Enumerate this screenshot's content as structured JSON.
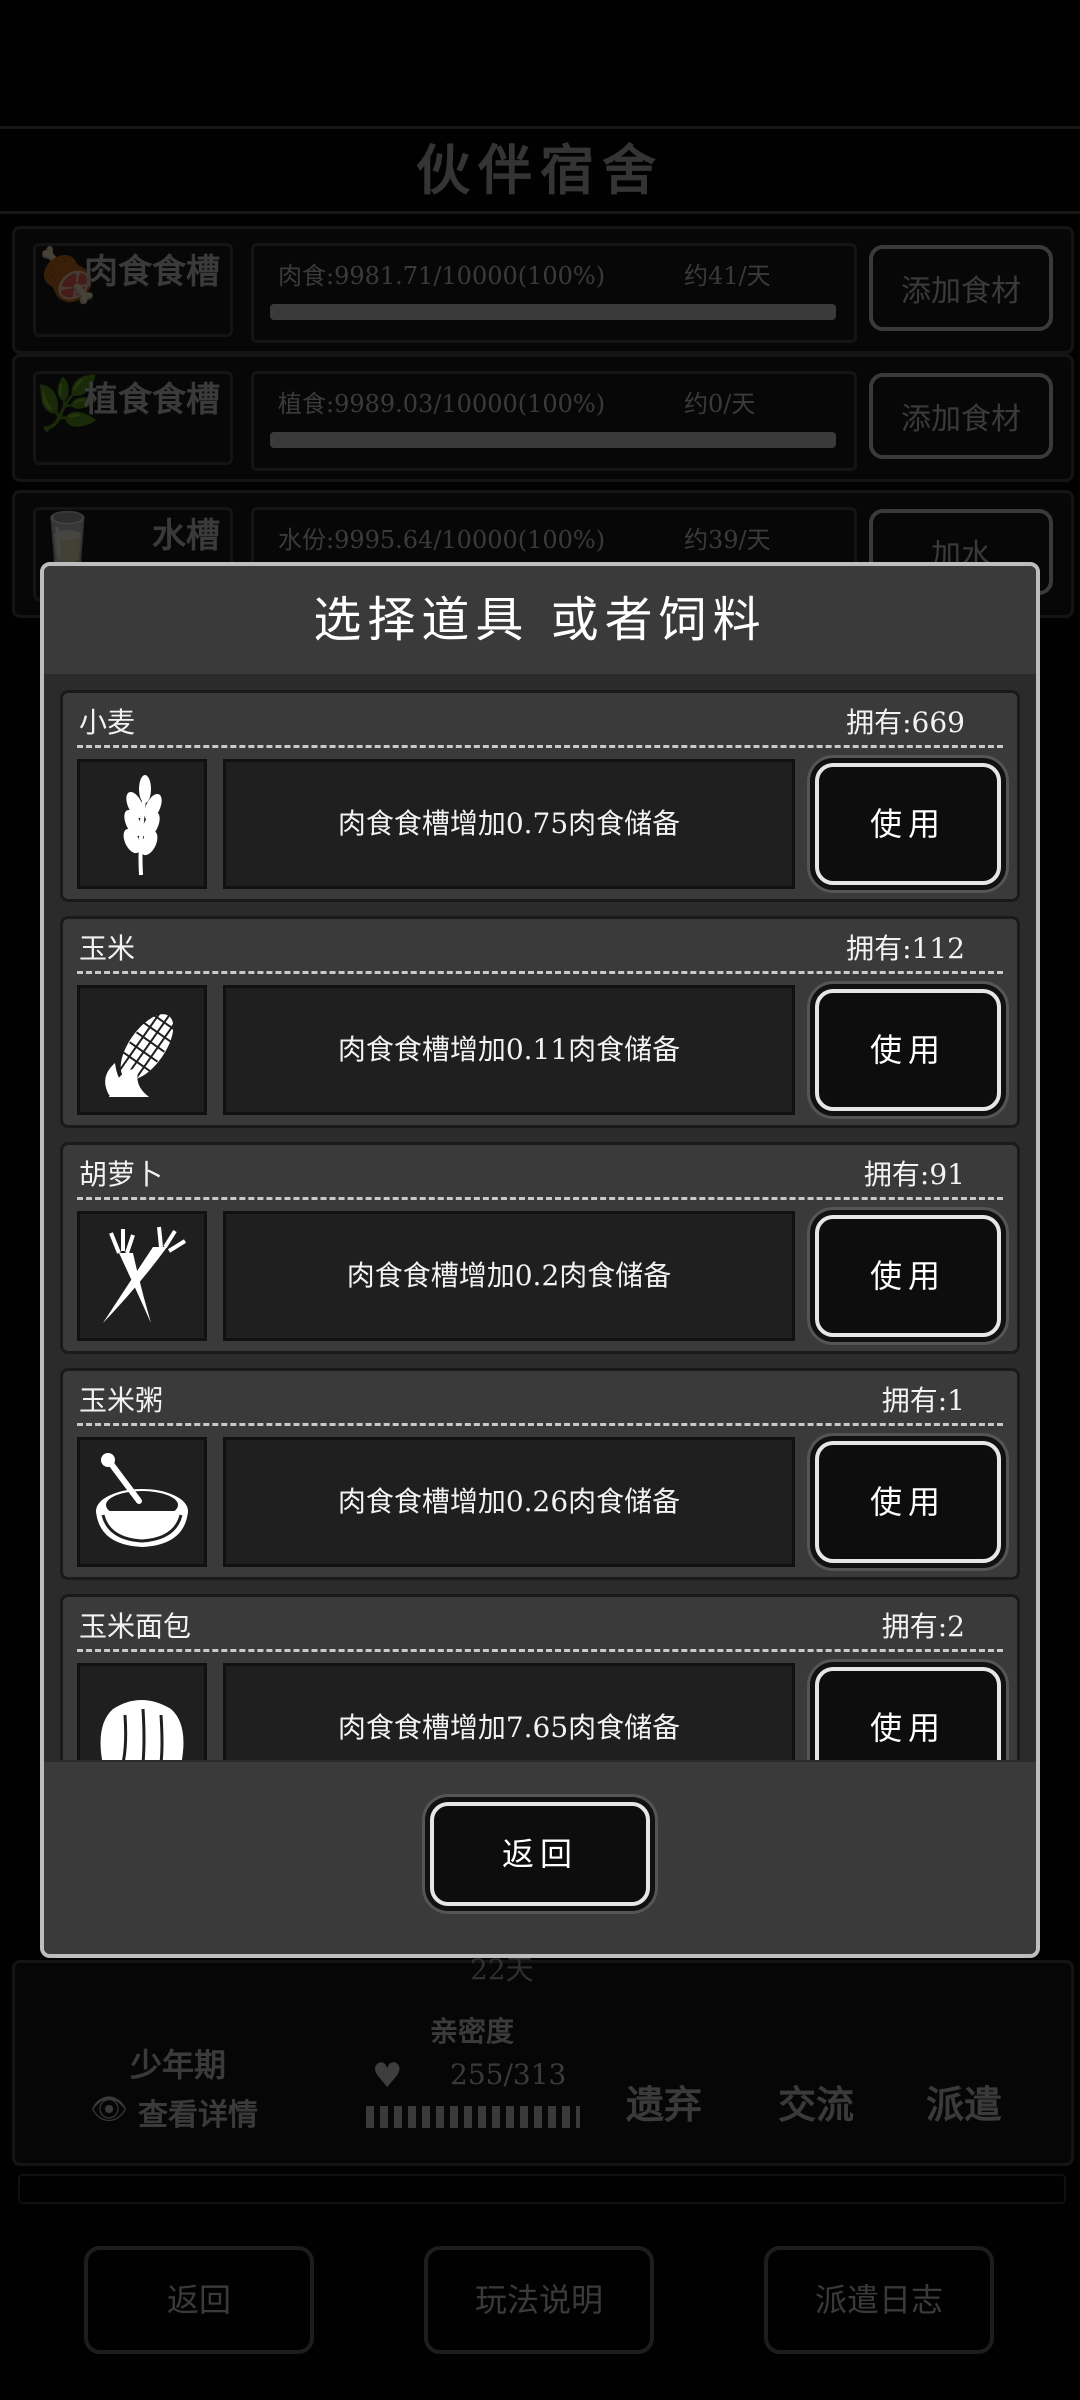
{
  "background": {
    "title": "伙伴宿舍",
    "troughs": [
      {
        "label": "肉食食槽",
        "amount": "肉食:9981.71/10000(100%)",
        "rate": "约41/天",
        "button": "添加食材",
        "fill": 1.0
      },
      {
        "label": "植食食槽",
        "amount": "植食:9989.03/10000(100%)",
        "rate": "约0/天",
        "button": "添加食材",
        "fill": 1.0
      },
      {
        "label": "水槽",
        "amount": "水份:9995.64/10000(100%)",
        "rate": "约39/天",
        "button": "加水",
        "fill": 1.0
      }
    ],
    "days": "22天",
    "stage": "少年期",
    "details": "查看详情",
    "intimacy_label": "亲密度",
    "intimacy_value": "255/313",
    "intimacy_fraction": 0.81,
    "actions": [
      "遗弃",
      "交流",
      "派遣"
    ],
    "footer_buttons": [
      "返回",
      "玩法说明",
      "派遣日志"
    ]
  },
  "modal": {
    "title": "选择道具 或者饲料",
    "use_label": "使用",
    "back_label": "返回",
    "items": [
      {
        "name": "小麦",
        "owned": "拥有:669",
        "desc": "肉食食槽增加0.75肉食储备",
        "icon": "wheat-icon"
      },
      {
        "name": "玉米",
        "owned": "拥有:112",
        "desc": "肉食食槽增加0.11肉食储备",
        "icon": "corn-icon"
      },
      {
        "name": "胡萝卜",
        "owned": "拥有:91",
        "desc": "肉食食槽增加0.2肉食储备",
        "icon": "carrot-icon"
      },
      {
        "name": "玉米粥",
        "owned": "拥有:1",
        "desc": "肉食食槽增加0.26肉食储备",
        "icon": "porridge-icon"
      },
      {
        "name": "玉米面包",
        "owned": "拥有:2",
        "desc": "肉食食槽增加7.65肉食储备",
        "icon": "bread-icon"
      }
    ]
  }
}
